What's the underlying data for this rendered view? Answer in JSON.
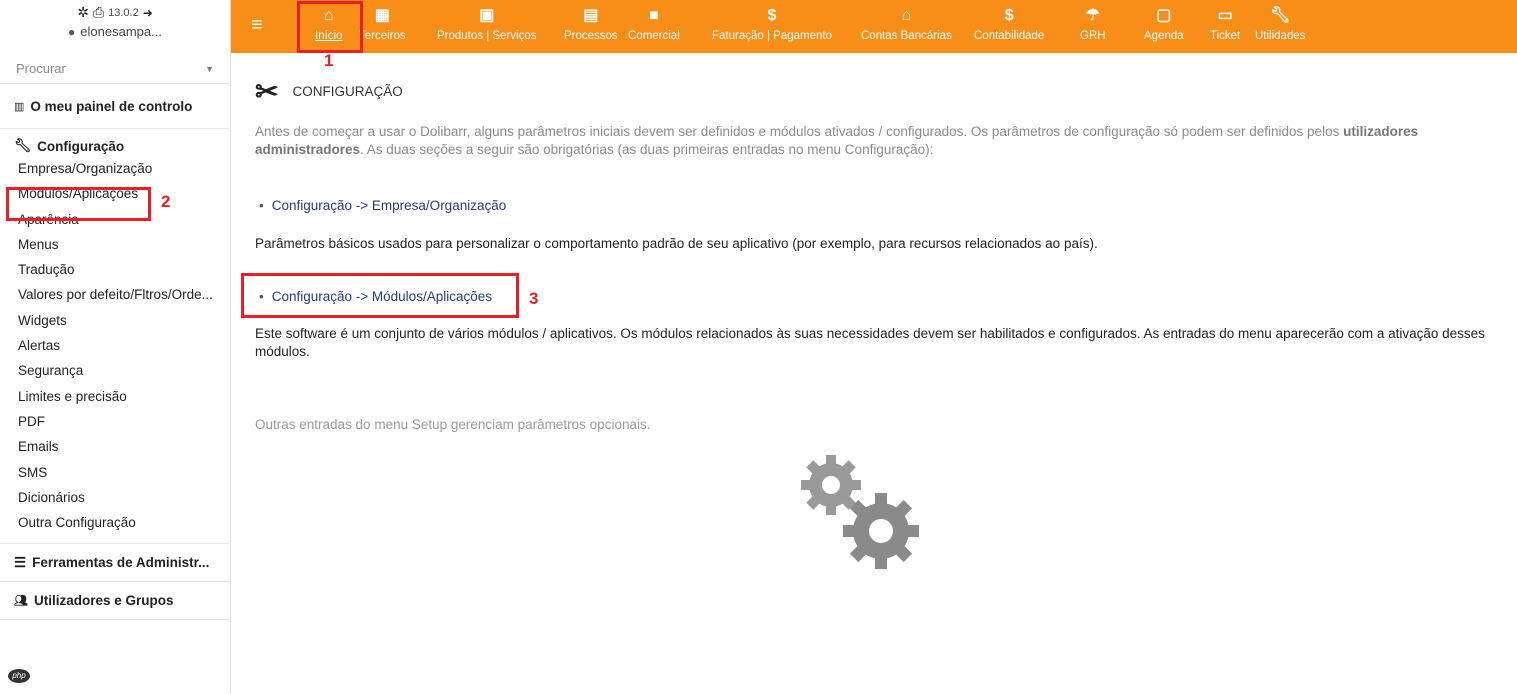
{
  "user_area": {
    "version": "13.0.2",
    "username": "elonesampa..."
  },
  "search": {
    "placeholder": "Procurar"
  },
  "sidebar": {
    "dashboard": "O meu painel de controlo",
    "setup_title": "Configuração",
    "setup_items": [
      "Empresa/Organização",
      "Módulos/Aplicações",
      "Aparência",
      "Menus",
      "Tradução",
      "Valores por defeito/Fltros/Orde...",
      "Widgets",
      "Alertas",
      "Segurança",
      "Limites e precisão",
      "PDF",
      "Emails",
      "SMS",
      "Dicionários",
      "Outra Configuração"
    ],
    "admin_tools": "Ferramentas de Administr...",
    "users_groups": "Utilizadores e Grupos"
  },
  "topbar": {
    "tabs": [
      {
        "label": "Início",
        "icon": "home-icon",
        "active": true
      },
      {
        "label": "Terceiros",
        "icon": "building-icon"
      },
      {
        "label": "Produtos | Serviços",
        "icon": "cube-icon"
      },
      {
        "label": "Processos",
        "icon": "clipboard-icon"
      },
      {
        "label": "Comercial",
        "icon": "briefcase-icon"
      },
      {
        "label": "Faturação | Pagamento",
        "icon": "dollar-icon"
      },
      {
        "label": "Contas Bancárias",
        "icon": "bank-icon"
      },
      {
        "label": "Contabilidade",
        "icon": "dollar-icon"
      },
      {
        "label": "GRH",
        "icon": "umbrella-icon"
      },
      {
        "label": "Agenda",
        "icon": "calendar-icon"
      },
      {
        "label": "Ticket",
        "icon": "ticket-icon"
      },
      {
        "label": "Utilidades",
        "icon": "wrench-icon"
      }
    ]
  },
  "annotations": [
    "1",
    "2",
    "3"
  ],
  "main": {
    "title": "CONFIGURAÇÃO",
    "intro_part1": "Antes de começar a usar o Dolibarr, alguns parâmetros iniciais devem ser definidos e módulos ativados / configurados. Os parâmetros de configuração só podem ser definidos pelos ",
    "intro_bold": "utilizadores administradores",
    "intro_part2": ". As duas seções a seguir são obrigatórias (as duas primeiras entradas no menu Configuração):",
    "link1": "Configuração -> Empresa/Organização",
    "desc1": "Parâmetros básicos usados para personalizar o comportamento padrão de seu aplicativo (por exemplo, para recursos relacionados ao país).",
    "link2": "Configuração -> Módulos/Aplicações",
    "desc2": "Este software é um conjunto de vários módulos / aplicativos. Os módulos relacionados às suas necessidades devem ser habilitados e configurados. As entradas do menu aparecerão com a ativação desses módulos.",
    "note": "Outras entradas do menu Setup gerenciam parâmetros opcionais."
  },
  "colors": {
    "topbar": "#f88d18",
    "annotation": "#e8202a",
    "link": "#263c7a"
  }
}
